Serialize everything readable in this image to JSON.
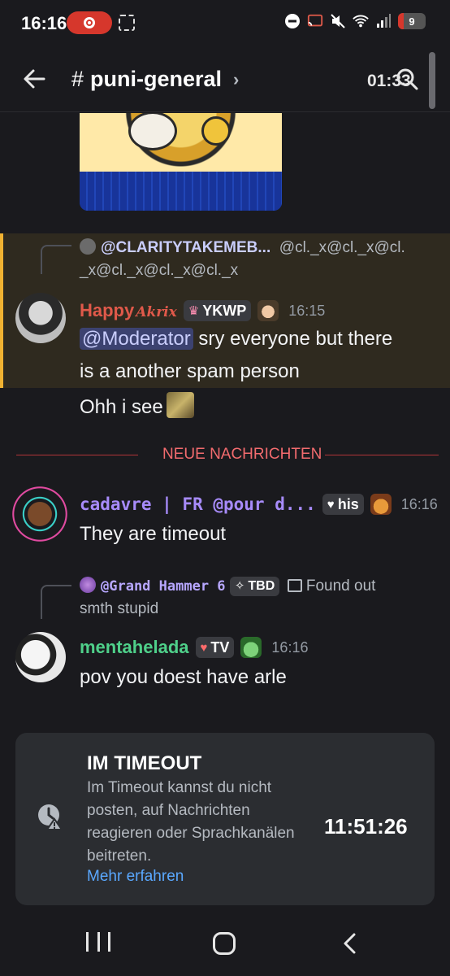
{
  "status_bar": {
    "time": "16:16",
    "battery_level": "9",
    "battery_fraction": 0.09
  },
  "header": {
    "hash": "#",
    "channel_name": "puni-general",
    "time_overlay": "01:33"
  },
  "messages": [
    {
      "reply_to": {
        "name": "@CLARITYTAKEMEB...",
        "text": "@cl._x@cl._x@cl.",
        "text2": "_x@cl._x@cl._x@cl._x"
      },
      "username": "Happy",
      "username_suffix": "Akrix",
      "username_color": "#e0594a",
      "tag": "YKWP",
      "time": "16:15",
      "mention": "@Moderator",
      "text_after_mention": " sry everyone but there",
      "text_line2": "is a another spam person",
      "followup": "Ohh i see",
      "highlighted": true
    },
    {
      "username": "cadavre | FR @pour d...",
      "username_color": "#a78bfa",
      "tag": "his",
      "time": "16:16",
      "text": "They are timeout"
    },
    {
      "reply_to": {
        "name": "@Grand Hammer 6",
        "tag": "TBD",
        "text": "Found out",
        "text2": "smth stupid"
      },
      "username": "mentahelada",
      "username_color": "#4fd08a",
      "tag": "TV",
      "time": "16:16",
      "text": "pov you doest have arle"
    }
  ],
  "divider_label": "NEUE NACHRICHTEN",
  "timeout_card": {
    "title": "IM TIMEOUT",
    "description": "Im Timeout kannst du nicht posten, auf Nachrichten reagieren oder Sprachkanälen beitreten.",
    "link": "Mehr erfahren",
    "timer": "11:51:26"
  },
  "colors": {
    "background": "#1a1a1e",
    "highlight_bar": "#f0b232",
    "divider": "#f23f42",
    "link": "#5aa8ff"
  }
}
